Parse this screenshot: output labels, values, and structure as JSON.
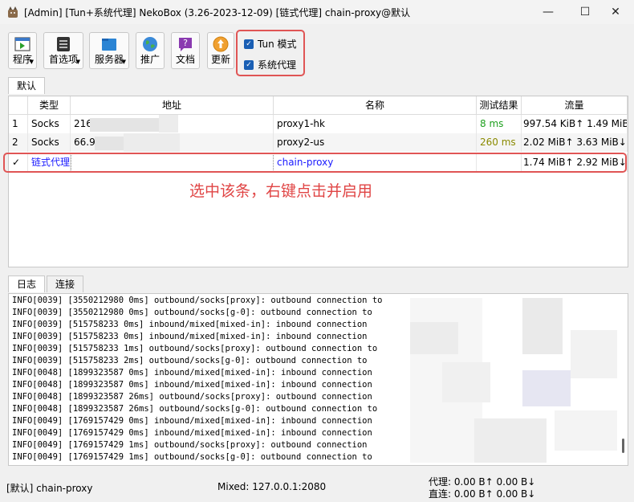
{
  "window": {
    "title": "[Admin] [Tun+系统代理] NekoBox (3.26-2023-12-09) [链式代理] chain-proxy@默认",
    "minimize": "—",
    "maximize": "☐",
    "close": "✕"
  },
  "toolbar": {
    "buttons": [
      {
        "label": "程序",
        "icon": "program-icon"
      },
      {
        "label": "首选项",
        "icon": "preferences-icon"
      },
      {
        "label": "服务器",
        "icon": "server-icon"
      },
      {
        "label": "推广",
        "icon": "globe-icon"
      },
      {
        "label": "文档",
        "icon": "help-doc-icon"
      },
      {
        "label": "更新",
        "icon": "update-icon"
      }
    ],
    "tun_mode": {
      "label": "Tun 模式",
      "checked": true
    },
    "system_proxy": {
      "label": "系统代理",
      "checked": true
    }
  },
  "group_tabs": [
    "默认"
  ],
  "table": {
    "columns": [
      "",
      "类型",
      "地址",
      "名称",
      "测试结果",
      "流量"
    ],
    "rows": [
      {
        "idx": "1",
        "type": "Socks",
        "address": "216",
        "name": "proxy1-hk",
        "latency": "8 ms",
        "traffic": "997.54 KiB↑ 1.49 MiB↓"
      },
      {
        "idx": "2",
        "type": "Socks",
        "address": "66.9",
        "name": "proxy2-us",
        "latency": "260 ms",
        "traffic": "2.02 MiB↑ 3.63 MiB↓"
      },
      {
        "idx": "✓",
        "type": "链式代理",
        "address": "",
        "name": "chain-proxy",
        "latency": "",
        "traffic": "1.74 MiB↑ 2.92 MiB↓"
      }
    ]
  },
  "annotation": "选中该条，右键点击并启用",
  "bottom_tabs": [
    "日志",
    "连接"
  ],
  "log": [
    "INFO[0039] [3550212980 0ms] outbound/socks[proxy]: outbound connection to",
    "INFO[0039] [3550212980 0ms] outbound/socks[g-0]: outbound connection to",
    "INFO[0039] [515758233 0ms] inbound/mixed[mixed-in]: inbound connection",
    "INFO[0039] [515758233 0ms] inbound/mixed[mixed-in]: inbound connection",
    "INFO[0039] [515758233 1ms] outbound/socks[proxy]: outbound connection to",
    "INFO[0039] [515758233 2ms] outbound/socks[g-0]: outbound connection to",
    "INFO[0048] [1899323587 0ms] inbound/mixed[mixed-in]: inbound connection",
    "INFO[0048] [1899323587 0ms] inbound/mixed[mixed-in]: inbound connection",
    "INFO[0048] [1899323587 26ms] outbound/socks[proxy]: outbound connection",
    "INFO[0048] [1899323587 26ms] outbound/socks[g-0]: outbound connection to",
    "INFO[0049] [1769157429 0ms] inbound/mixed[mixed-in]: inbound connection",
    "INFO[0049] [1769157429 0ms] inbound/mixed[mixed-in]: inbound connection",
    "INFO[0049] [1769157429 1ms] outbound/socks[proxy]: outbound connection",
    "INFO[0049] [1769157429 1ms] outbound/socks[g-0]: outbound connection to"
  ],
  "status": {
    "active": "[默认] chain-proxy",
    "mixed": "Mixed: 127.0.0.1:2080",
    "proxy_speed": "代理: 0.00 B↑ 0.00 B↓",
    "direct_speed": "直连: 0.00 B↑ 0.00 B↓"
  },
  "colors": {
    "latency_good": "#1fa01f",
    "latency_medium": "#8a8a00",
    "active_row_text": "#1a1aff",
    "highlight_border": "#e05555",
    "checkbox": "#1a5fb4"
  }
}
